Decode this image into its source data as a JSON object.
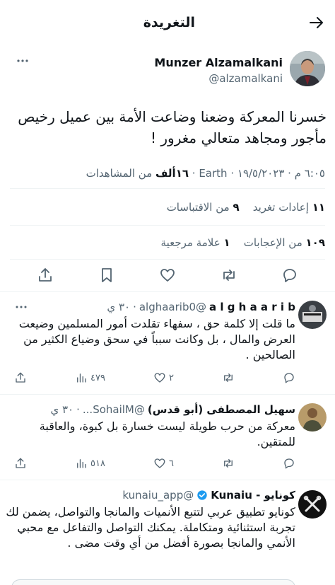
{
  "header": {
    "title": "التغريدة"
  },
  "tweet": {
    "author_name": "Munzer Alzamalkani",
    "author_handle": "@alzamalkani",
    "text": "خسرنا المعركة وضعنا وضاعت الأمة بين عميل رخيص مأجور ومجاهد متعالي مغرور !",
    "meta": {
      "time_date": "٦:٠٥ م · ١٩/٥/٢٠٢٣",
      "source": "Earth",
      "views_count": "١٦ألف",
      "views_label": "من المشاهدات"
    },
    "stats": {
      "retweets_count": "١١",
      "retweets_label": "إعادات تغريد",
      "quotes_count": "٩",
      "quotes_label": "من الاقتباسات",
      "likes_count": "١٠٩",
      "likes_label": "من الإعجابات",
      "bookmarks_count": "١",
      "bookmarks_label": "علامة مرجعية"
    }
  },
  "replies": [
    {
      "name": "a l g h a a r i b",
      "handle": "@alghaarib0",
      "time": "٣٠ ي",
      "text": "ما قلت إلا كلمة حق ، سفهاء تقلدت أمور المسلمين وضيعت العرض والمال ، بل وكانت سبباً في سحق وضياع الكثير من الصالحين .",
      "views": "٤٧٩",
      "likes": "٢"
    },
    {
      "name": "سهيل المصطفى (أبو قدس)",
      "handle": "@SohailM...",
      "time": "٣٠ ي",
      "text": "معركة من حرب طويلة ليست خسارة بل كبوة، والعاقبة للمتقين.",
      "views": "٥١٨",
      "likes": "٦"
    },
    {
      "name": "كونايو - Kunaiu",
      "handle": "@kunaiu_app",
      "text": "كونايو تطبيق عربي لتتبع الأنميات والمانجا والتواصل، يضمن لك تجربة استثنائية ومتكاملة. يمكنك التواصل والتفاعل مع محبي الأنمي والمانجا بصورة أفضل من أي وقت مضى ."
    }
  ],
  "colors": {
    "accent": "#1d9bf0",
    "text": "#0f1419",
    "secondary": "#536471",
    "divider": "#eff3f4"
  }
}
